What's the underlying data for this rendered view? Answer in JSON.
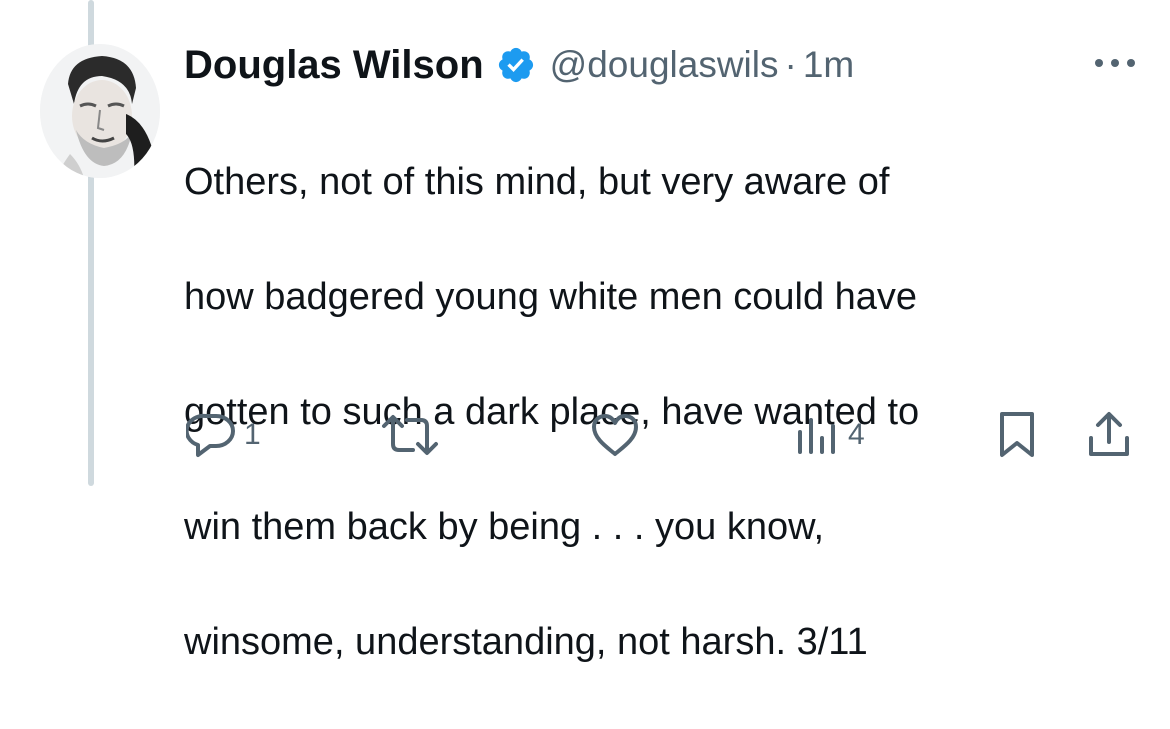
{
  "tweet": {
    "author_name": "Douglas Wilson",
    "handle": "@douglaswils",
    "separator": "·",
    "time": "1m",
    "text_lines": [
      "Others, not of this mind, but very aware of",
      "how badgered young white men could have",
      "gotten to such a dark place, have wanted to",
      "win them back by being . . . you know,",
      "winsome, understanding, not harsh. 3/11"
    ]
  },
  "actions": {
    "reply_count": "1",
    "views_count": "4"
  },
  "icons": {
    "verified": "verified-badge-icon",
    "more": "more-icon",
    "reply": "reply-icon",
    "retweet": "retweet-icon",
    "like": "like-icon",
    "views": "views-icon",
    "bookmark": "bookmark-icon",
    "share": "share-icon"
  },
  "colors": {
    "text": "#0f1419",
    "secondary": "#536471",
    "verified": "#1d9bf0",
    "thread_line": "#cfd9de"
  }
}
